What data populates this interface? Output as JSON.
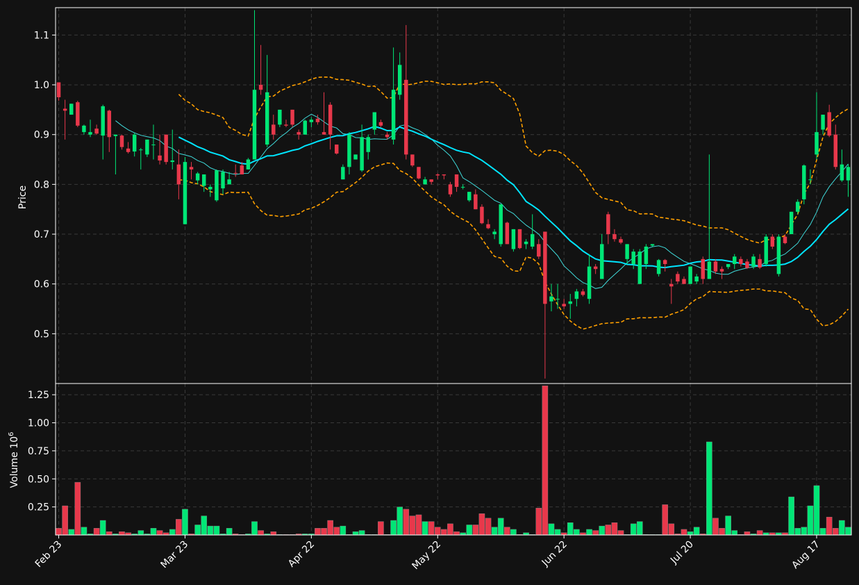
{
  "chart_data": {
    "type": "candlestick",
    "price_panel": {
      "ylabel": "Price",
      "ylim": [
        0.4,
        1.155
      ],
      "yticks": [
        0.5,
        0.6,
        0.7,
        0.8,
        0.9,
        1.0,
        1.1
      ],
      "ytick_labels": [
        "0.5",
        "0.6",
        "0.7",
        "0.8",
        "0.9",
        "1.0",
        "1.1"
      ],
      "grid": true
    },
    "volume_panel": {
      "ylabel": "Volume  10",
      "ylabel_exponent": "6",
      "ylim": [
        0,
        1.35
      ],
      "yticks": [
        0.25,
        0.5,
        0.75,
        1.0,
        1.25
      ],
      "ytick_labels": [
        "0.25",
        "0.50",
        "0.75",
        "1.00",
        "1.25"
      ],
      "grid": true
    },
    "xticks": [
      {
        "i": 0,
        "label": "Feb 23"
      },
      {
        "i": 20,
        "label": "Mar 23"
      },
      {
        "i": 40,
        "label": "Apr 22"
      },
      {
        "i": 60,
        "label": "May 22"
      },
      {
        "i": 80,
        "label": "Jun 22"
      },
      {
        "i": 100,
        "label": "Jul 20"
      },
      {
        "i": 120,
        "label": "Aug 17"
      }
    ],
    "colors": {
      "up": "#00e676",
      "down": "#e8384b",
      "ma_fast": "#3fd9d9",
      "ma_slow": "#00e5ff",
      "bands": "#ffa000",
      "background": "#121212",
      "grid": "#3a3a3a"
    },
    "ma_fast_window": 10,
    "ma_slow_window": 20,
    "bands_window": 20,
    "candles": [
      [
        1.005,
        1.005,
        0.968,
        0.975,
        0.06
      ],
      [
        0.952,
        0.97,
        0.89,
        0.948,
        0.26
      ],
      [
        0.94,
        0.962,
        0.94,
        0.962,
        0.05
      ],
      [
        0.965,
        0.968,
        0.915,
        0.918,
        0.47
      ],
      [
        0.905,
        0.92,
        0.9,
        0.918,
        0.07
      ],
      [
        0.9,
        0.93,
        0.895,
        0.905,
        0.01
      ],
      [
        0.912,
        0.92,
        0.9,
        0.902,
        0.06
      ],
      [
        0.898,
        0.96,
        0.85,
        0.957,
        0.13
      ],
      [
        0.948,
        0.95,
        0.865,
        0.895,
        0.03
      ],
      [
        0.897,
        0.9,
        0.82,
        0.9,
        0.01
      ],
      [
        0.898,
        0.9,
        0.87,
        0.875,
        0.03
      ],
      [
        0.872,
        0.885,
        0.862,
        0.865,
        0.02
      ],
      [
        0.866,
        0.903,
        0.856,
        0.9,
        0.01
      ],
      [
        0.87,
        0.873,
        0.83,
        0.87,
        0.04
      ],
      [
        0.86,
        0.89,
        0.855,
        0.89,
        0.01
      ],
      [
        0.88,
        0.92,
        0.85,
        0.88,
        0.06
      ],
      [
        0.858,
        0.9,
        0.84,
        0.848,
        0.04
      ],
      [
        0.9,
        0.9,
        0.84,
        0.845,
        0.02
      ],
      [
        0.845,
        0.91,
        0.83,
        0.848,
        0.05
      ],
      [
        0.84,
        0.87,
        0.77,
        0.8,
        0.14
      ],
      [
        0.72,
        0.855,
        0.72,
        0.845,
        0.23
      ],
      [
        0.835,
        0.845,
        0.81,
        0.83,
        0.01
      ],
      [
        0.808,
        0.825,
        0.8,
        0.822,
        0.09
      ],
      [
        0.797,
        0.82,
        0.785,
        0.82,
        0.17
      ],
      [
        0.79,
        0.8,
        0.775,
        0.795,
        0.08
      ],
      [
        0.768,
        0.83,
        0.765,
        0.828,
        0.08
      ],
      [
        0.792,
        0.83,
        0.78,
        0.825,
        0.01
      ],
      [
        0.8,
        0.825,
        0.8,
        0.81,
        0.06
      ],
      [
        0.823,
        0.84,
        0.815,
        0.822,
        0.01
      ],
      [
        0.838,
        0.845,
        0.82,
        0.82,
        0.005
      ],
      [
        0.83,
        0.853,
        0.83,
        0.85,
        0.01
      ],
      [
        0.85,
        1.15,
        0.85,
        0.99,
        0.12
      ],
      [
        1.0,
        1.08,
        0.98,
        0.99,
        0.04
      ],
      [
        0.88,
        1.06,
        0.875,
        0.985,
        0.01
      ],
      [
        0.92,
        0.94,
        0.89,
        0.9,
        0.03
      ],
      [
        0.92,
        0.95,
        0.915,
        0.95,
        0.005
      ],
      [
        0.92,
        0.93,
        0.915,
        0.918,
        0.005
      ],
      [
        0.95,
        0.95,
        0.915,
        0.92,
        0.005
      ],
      [
        0.905,
        0.91,
        0.89,
        0.9,
        0.01
      ],
      [
        0.9,
        0.93,
        0.9,
        0.928,
        0.01
      ],
      [
        0.925,
        0.935,
        0.915,
        0.93,
        0.01
      ],
      [
        0.932,
        0.94,
        0.92,
        0.925,
        0.06
      ],
      [
        0.905,
        0.985,
        0.9,
        0.9,
        0.06
      ],
      [
        0.96,
        0.965,
        0.87,
        0.9,
        0.13
      ],
      [
        0.88,
        0.88,
        0.86,
        0.862,
        0.07
      ],
      [
        0.81,
        0.84,
        0.81,
        0.835,
        0.08
      ],
      [
        0.835,
        0.905,
        0.82,
        0.9,
        0.005
      ],
      [
        0.85,
        0.86,
        0.85,
        0.86,
        0.03
      ],
      [
        0.828,
        0.92,
        0.825,
        0.895,
        0.04
      ],
      [
        0.865,
        0.9,
        0.85,
        0.895,
        0.005
      ],
      [
        0.91,
        0.945,
        0.9,
        0.945,
        0.005
      ],
      [
        0.925,
        0.93,
        0.915,
        0.918,
        0.12
      ],
      [
        0.9,
        0.905,
        0.89,
        0.895,
        0.005
      ],
      [
        0.89,
        1.075,
        0.88,
        0.99,
        0.13
      ],
      [
        0.98,
        1.065,
        0.97,
        1.04,
        0.25
      ],
      [
        1.01,
        1.12,
        0.85,
        0.86,
        0.23
      ],
      [
        0.86,
        0.86,
        0.835,
        0.838,
        0.17
      ],
      [
        0.835,
        0.835,
        0.81,
        0.812,
        0.18
      ],
      [
        0.8,
        0.815,
        0.8,
        0.81,
        0.12
      ],
      [
        0.81,
        0.81,
        0.8,
        0.805,
        0.12
      ],
      [
        0.82,
        0.822,
        0.81,
        0.818,
        0.07
      ],
      [
        0.82,
        0.82,
        0.81,
        0.818,
        0.05
      ],
      [
        0.8,
        0.805,
        0.775,
        0.78,
        0.1
      ],
      [
        0.82,
        0.82,
        0.785,
        0.795,
        0.03
      ],
      [
        0.795,
        0.8,
        0.79,
        0.795,
        0.02
      ],
      [
        0.768,
        0.785,
        0.765,
        0.785,
        0.09
      ],
      [
        0.78,
        0.79,
        0.75,
        0.75,
        0.09
      ],
      [
        0.755,
        0.76,
        0.72,
        0.722,
        0.19
      ],
      [
        0.72,
        0.73,
        0.71,
        0.712,
        0.15
      ],
      [
        0.7,
        0.71,
        0.69,
        0.705,
        0.07
      ],
      [
        0.68,
        0.76,
        0.675,
        0.76,
        0.15
      ],
      [
        0.723,
        0.725,
        0.68,
        0.68,
        0.07
      ],
      [
        0.67,
        0.71,
        0.665,
        0.71,
        0.05
      ],
      [
        0.71,
        0.71,
        0.67,
        0.672,
        0.005
      ],
      [
        0.68,
        0.69,
        0.67,
        0.685,
        0.02
      ],
      [
        0.675,
        0.74,
        0.67,
        0.7,
        0.005
      ],
      [
        0.68,
        0.69,
        0.65,
        0.655,
        0.24
      ],
      [
        0.705,
        0.705,
        0.41,
        0.56,
        1.33
      ],
      [
        0.565,
        0.6,
        0.545,
        0.575,
        0.1
      ],
      [
        0.57,
        0.6,
        0.55,
        0.57,
        0.05
      ],
      [
        0.56,
        0.57,
        0.55,
        0.555,
        0.02
      ],
      [
        0.56,
        0.58,
        0.53,
        0.565,
        0.11
      ],
      [
        0.57,
        0.59,
        0.555,
        0.585,
        0.05
      ],
      [
        0.585,
        0.59,
        0.575,
        0.578,
        0.02
      ],
      [
        0.57,
        0.66,
        0.56,
        0.635,
        0.05
      ],
      [
        0.635,
        0.64,
        0.62,
        0.63,
        0.04
      ],
      [
        0.61,
        0.7,
        0.61,
        0.68,
        0.08
      ],
      [
        0.74,
        0.745,
        0.68,
        0.7,
        0.09
      ],
      [
        0.7,
        0.71,
        0.685,
        0.69,
        0.11
      ],
      [
        0.69,
        0.695,
        0.68,
        0.683,
        0.04
      ],
      [
        0.65,
        0.68,
        0.64,
        0.68,
        0.005
      ],
      [
        0.64,
        0.67,
        0.63,
        0.665,
        0.1
      ],
      [
        0.6,
        0.67,
        0.6,
        0.665,
        0.12
      ],
      [
        0.64,
        0.68,
        0.63,
        0.675,
        0.005
      ],
      [
        0.677,
        0.68,
        0.675,
        0.68,
        0.005
      ],
      [
        0.62,
        0.65,
        0.615,
        0.648,
        0.005
      ],
      [
        0.648,
        0.65,
        0.625,
        0.64,
        0.27
      ],
      [
        0.6,
        0.61,
        0.56,
        0.595,
        0.1
      ],
      [
        0.62,
        0.625,
        0.6,
        0.605,
        0.01
      ],
      [
        0.61,
        0.615,
        0.6,
        0.6,
        0.05
      ],
      [
        0.6,
        0.63,
        0.6,
        0.635,
        0.03
      ],
      [
        0.605,
        0.62,
        0.6,
        0.615,
        0.07
      ],
      [
        0.65,
        0.655,
        0.6,
        0.61,
        0.01
      ],
      [
        0.61,
        0.86,
        0.61,
        0.645,
        0.83
      ],
      [
        0.645,
        0.65,
        0.62,
        0.625,
        0.15
      ],
      [
        0.63,
        0.635,
        0.61,
        0.625,
        0.06
      ],
      [
        0.634,
        0.64,
        0.63,
        0.64,
        0.17
      ],
      [
        0.64,
        0.66,
        0.63,
        0.655,
        0.04
      ],
      [
        0.65,
        0.655,
        0.635,
        0.64,
        0.005
      ],
      [
        0.645,
        0.65,
        0.63,
        0.632,
        0.03
      ],
      [
        0.635,
        0.66,
        0.63,
        0.655,
        0.01
      ],
      [
        0.65,
        0.66,
        0.63,
        0.633,
        0.04
      ],
      [
        0.64,
        0.7,
        0.635,
        0.695,
        0.02
      ],
      [
        0.695,
        0.7,
        0.67,
        0.675,
        0.02
      ],
      [
        0.62,
        0.7,
        0.615,
        0.695,
        0.02
      ],
      [
        0.695,
        0.7,
        0.68,
        0.682,
        0.02
      ],
      [
        0.7,
        0.745,
        0.7,
        0.745,
        0.34
      ],
      [
        0.745,
        0.77,
        0.74,
        0.765,
        0.06
      ],
      [
        0.77,
        0.84,
        0.76,
        0.838,
        0.07
      ],
      [
        0.81,
        0.83,
        0.8,
        0.81,
        0.26
      ],
      [
        0.86,
        0.985,
        0.85,
        0.905,
        0.44
      ],
      [
        0.91,
        0.94,
        0.9,
        0.94,
        0.06
      ],
      [
        0.945,
        0.96,
        0.895,
        0.898,
        0.16
      ],
      [
        0.9,
        0.92,
        0.83,
        0.835,
        0.06
      ],
      [
        0.808,
        0.87,
        0.805,
        0.84,
        0.13
      ],
      [
        0.808,
        0.84,
        0.775,
        0.835,
        0.07
      ]
    ]
  }
}
